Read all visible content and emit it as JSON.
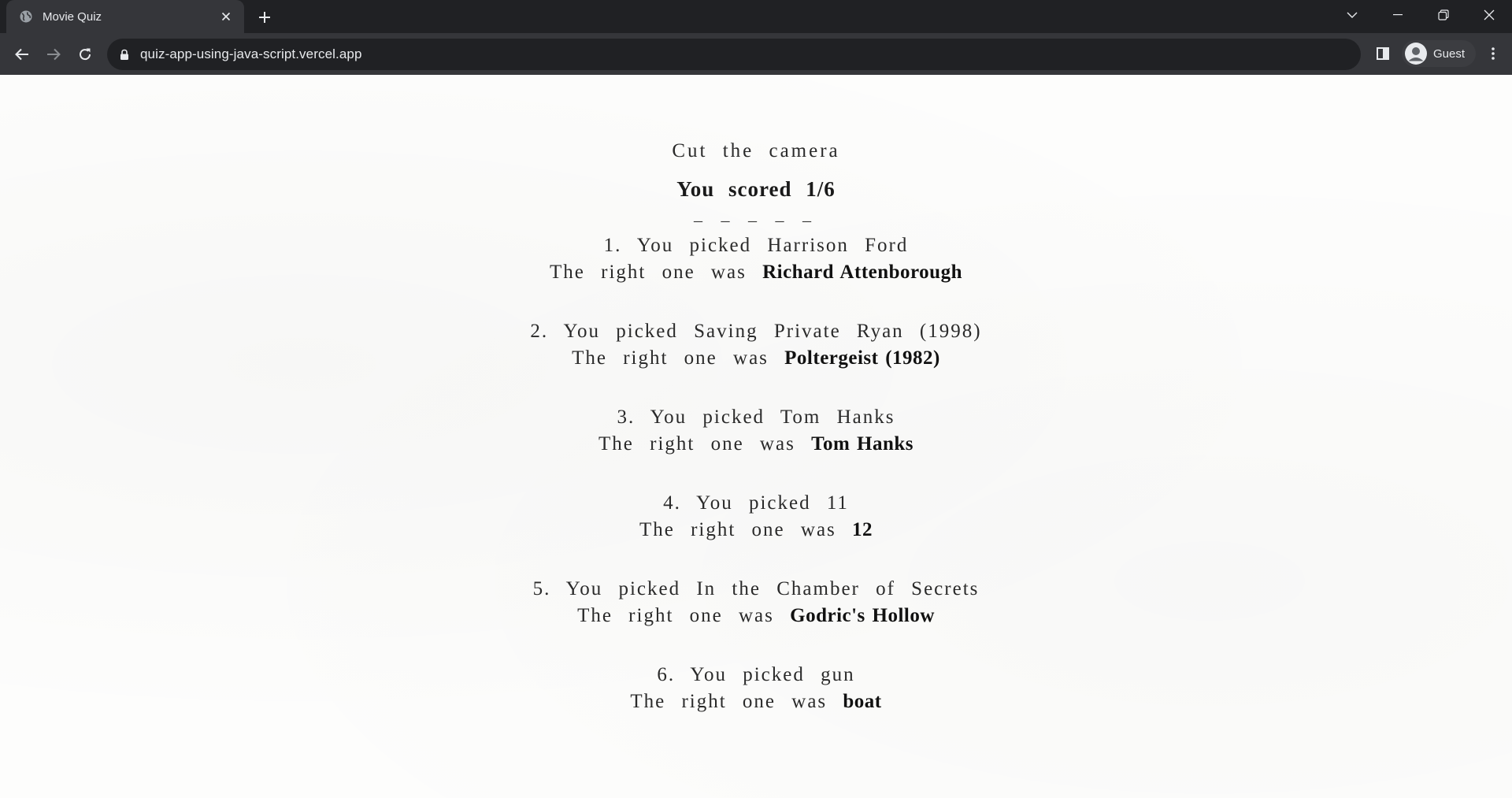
{
  "browser": {
    "tab": {
      "title": "Movie Quiz",
      "favicon_icon": "globe-icon"
    },
    "url": "quiz-app-using-java-script.vercel.app",
    "profile_name": "Guest"
  },
  "quiz": {
    "title": "Cut the camera",
    "score_text": "You scored 1/6",
    "divider": "_ _ _ _ _",
    "answers": [
      {
        "picked_text": "1. You picked Harrison Ford",
        "correct_prefix": "The right one was",
        "correct_answer": "Richard Attenborough"
      },
      {
        "picked_text": "2. You picked Saving Private Ryan (1998)",
        "correct_prefix": "The right one was",
        "correct_answer": "Poltergeist (1982)"
      },
      {
        "picked_text": "3. You picked Tom Hanks",
        "correct_prefix": "The right one was",
        "correct_answer": "Tom Hanks"
      },
      {
        "picked_text": "4. You picked 11",
        "correct_prefix": "The right one was",
        "correct_answer": "12"
      },
      {
        "picked_text": "5. You picked In the Chamber of Secrets",
        "correct_prefix": "The right one was",
        "correct_answer": "Godric's Hollow"
      },
      {
        "picked_text": "6. You picked gun",
        "correct_prefix": "The right one was",
        "correct_answer": "boat"
      }
    ]
  }
}
